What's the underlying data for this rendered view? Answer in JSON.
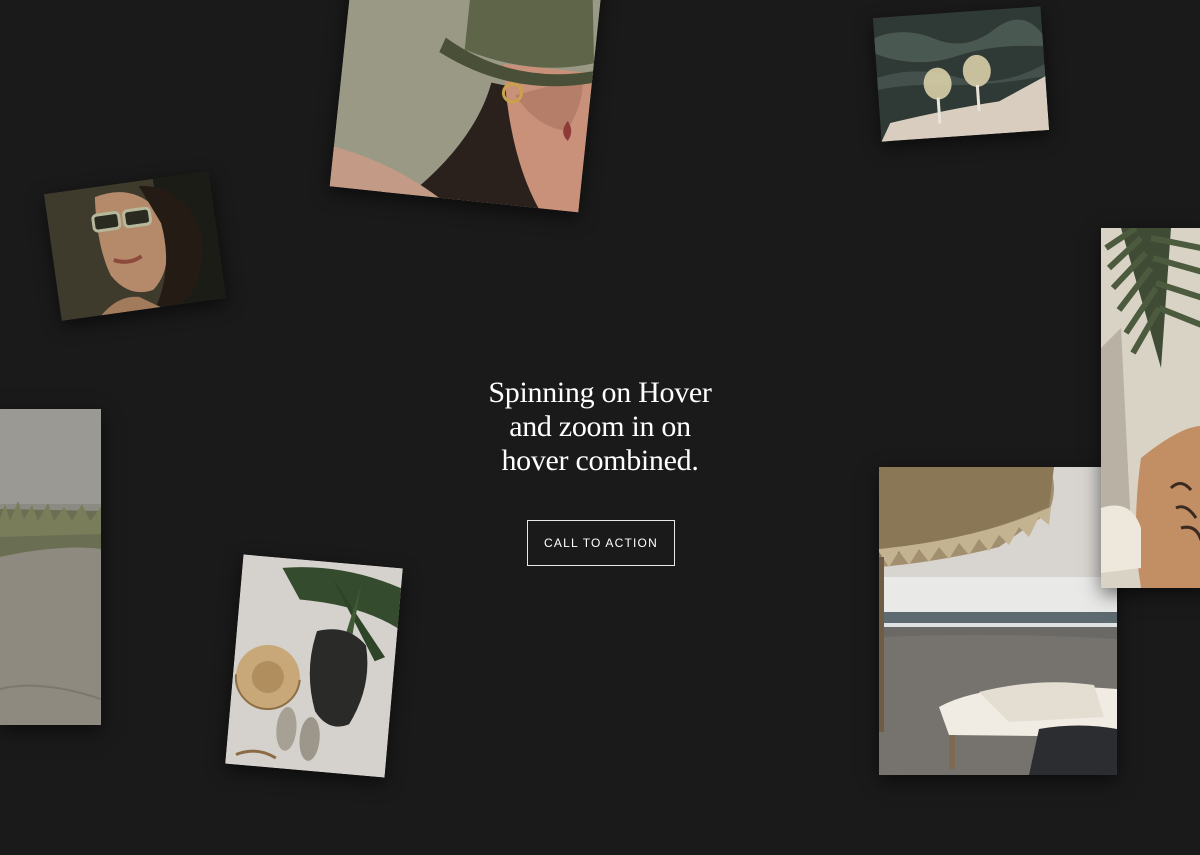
{
  "hero": {
    "title_lines": [
      "Spinning on Hover",
      "and zoom in on",
      "hover combined."
    ],
    "cta_label": "CALL TO ACTION"
  },
  "colors": {
    "background": "#1a1a1a",
    "text": "#ffffff",
    "cta_border": "#e8e8e8"
  },
  "gallery": [
    {
      "name": "photo-woman-bucket-hat",
      "subject": "woman in olive bucket hat"
    },
    {
      "name": "photo-wine-by-pool",
      "subject": "two wine glasses beside pool"
    },
    {
      "name": "photo-woman-sunglasses",
      "subject": "woman wearing sunglasses"
    },
    {
      "name": "photo-sand-dunes",
      "subject": "beach dunes"
    },
    {
      "name": "photo-beach-flatlay",
      "subject": "straw hat, sandals and swimsuit flat lay"
    },
    {
      "name": "photo-beach-lounger",
      "subject": "beach lounger under straw umbrella"
    },
    {
      "name": "photo-palm-shadow",
      "subject": "palm leaves and tattooed arm"
    }
  ]
}
